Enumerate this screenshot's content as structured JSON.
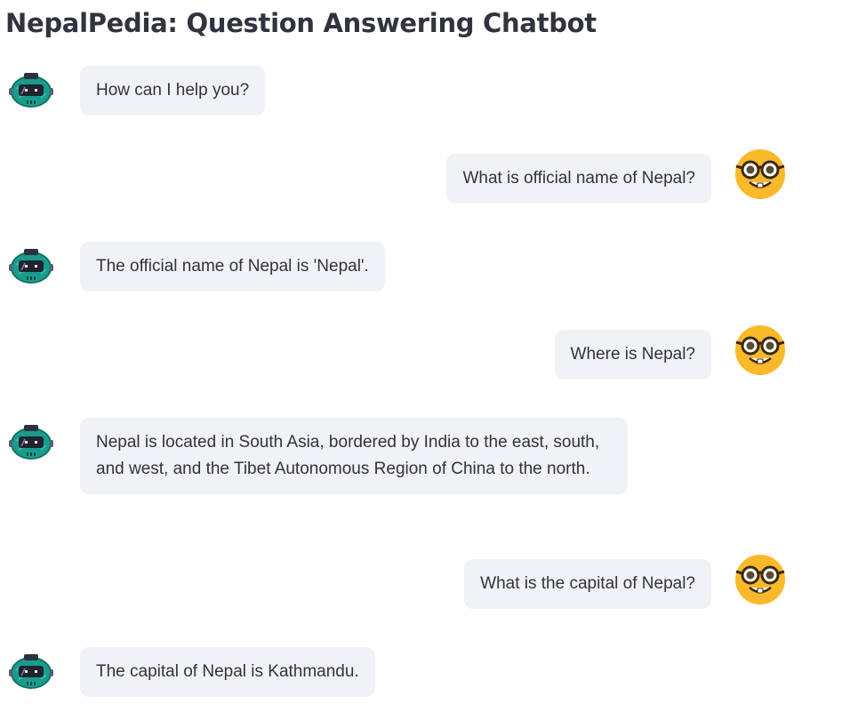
{
  "app": {
    "title": "NepalPedia: Question Answering Chatbot"
  },
  "avatars": {
    "bot": "robot-icon",
    "user": "nerd-face-icon"
  },
  "colors": {
    "bubble_bg": "#f0f2f6",
    "text": "#31333f",
    "bot_avatar": "#1a9c8c",
    "user_avatar": "#f9b92b"
  },
  "messages": [
    {
      "role": "assistant",
      "text": "How can I help you?"
    },
    {
      "role": "user",
      "text": "What is official name of Nepal?"
    },
    {
      "role": "assistant",
      "text": "The official name of Nepal is 'Nepal'."
    },
    {
      "role": "user",
      "text": "Where is Nepal?"
    },
    {
      "role": "assistant",
      "text": "Nepal is located in South Asia, bordered by India to the east, south, and west, and the Tibet Autonomous Region of China to the north."
    },
    {
      "role": "user",
      "text": "What is the capital of Nepal?"
    },
    {
      "role": "assistant",
      "text": "The capital of Nepal is Kathmandu."
    }
  ]
}
